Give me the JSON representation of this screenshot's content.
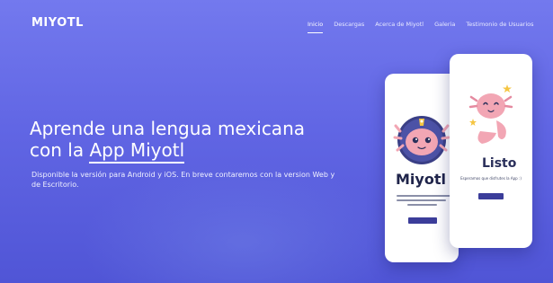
{
  "brand": {
    "logo": "MIYOTL"
  },
  "nav": {
    "items": [
      {
        "label": "Inicio",
        "active": true
      },
      {
        "label": "Descargas",
        "active": false
      },
      {
        "label": "Acerca de Miyotl",
        "active": false
      },
      {
        "label": "Galeria",
        "active": false
      },
      {
        "label": "Testimonio de Usuarios",
        "active": false
      }
    ]
  },
  "hero": {
    "headline_line1": "Aprende una lengua mexicana",
    "headline_prefix": "con la ",
    "headline_highlight": "App Miyotl",
    "subtitle": "Disponible la versión para Android y iOS. En breve contaremos con la version Web y de Escritorio."
  },
  "phones": {
    "back": {
      "app_title": "Miyotl"
    },
    "front": {
      "app_title": "Listo",
      "description": "Esperamos que disfrutes la App :)"
    }
  },
  "colors": {
    "background": "#6166e4",
    "button": "#3b3d9a",
    "mascot": "#f2a6b4"
  }
}
